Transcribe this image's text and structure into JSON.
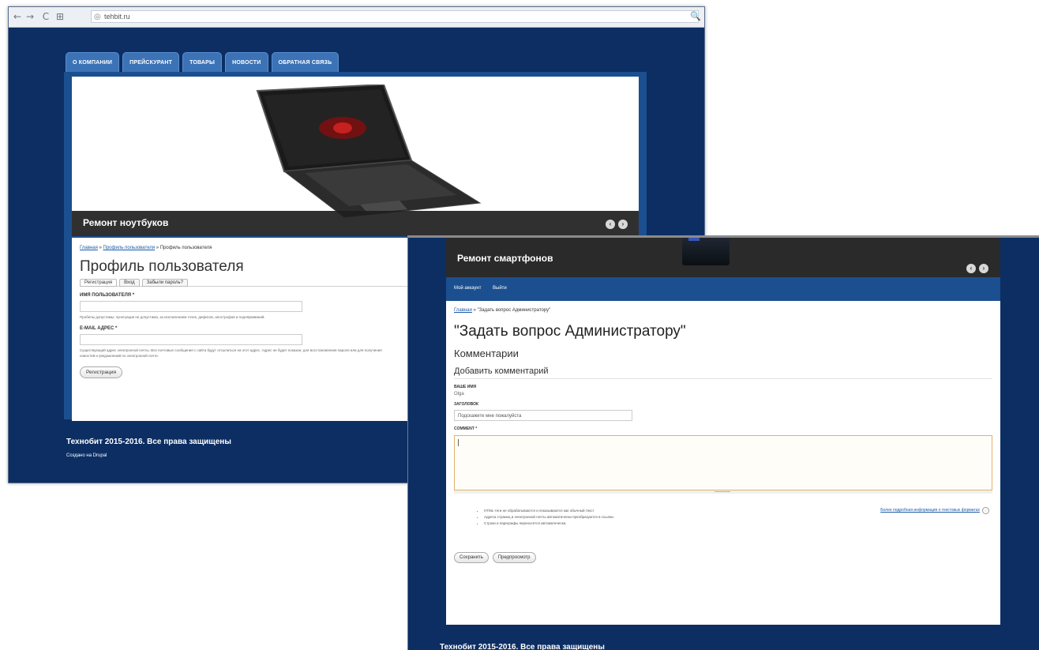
{
  "browser": {
    "back_icon": "←",
    "forward_icon": "→",
    "reload_icon": "C",
    "apps_icon": "⊞",
    "address": "tehbit.ru",
    "site_icon": "◎",
    "search_icon": "🔍"
  },
  "back_page": {
    "menu": [
      "О КОМПАНИИ",
      "ПРЕЙСКУРАНТ",
      "ТОВАРЫ",
      "НОВОСТИ",
      "ОБРАТНАЯ СВЯЗЬ"
    ],
    "slide_caption": "Ремонт ноутбуков",
    "slide_prev": "‹",
    "slide_next": "›",
    "breadcrumb": {
      "home": "Главная",
      "sep1": " » ",
      "profile": "Профиль пользователя",
      "sep2": " » ",
      "current": "Профиль пользователя"
    },
    "title": "Профиль пользователя",
    "tabs": [
      "Регистрация",
      "Вход",
      "Забыли пароль?"
    ],
    "form": {
      "username_label": "ИМЯ ПОЛЬЗОВАТЕЛЯ *",
      "username_hint": "Пробелы допустимы; пунктуация не допустима, за исключением точек, дефисов, апострофов и подчёркиваний.",
      "email_label": "E-MAIL АДРЕС *",
      "email_hint": "Существующий адрес электронной почты. Все почтовые сообщения с сайта будут отсылаться на этот адрес. Адрес не будет показан; для восстановления пароля или для получения новостей и уведомлений по электронной почте.",
      "submit": "Регистрация"
    },
    "footer_copyright": "Технобит 2015-2016. Все права защищены",
    "footer_credit": "Создано на Drupal"
  },
  "front_page": {
    "slide_caption": "Ремонт смартфонов",
    "slide_prev": "‹",
    "slide_next": "›",
    "user_menu": [
      "Мой аккаунт",
      "Выйти"
    ],
    "breadcrumb": {
      "home": "Главная",
      "sep": " » ",
      "current": "\"Задать вопрос Администратору\""
    },
    "title": "\"Задать вопрос Администратору\"",
    "comments_heading": "Комментарии",
    "add_comment_heading": "Добавить комментарий",
    "name_label": "ВАШЕ ИМЯ",
    "name_value": "Olga",
    "subject_label": "ЗАГОЛОВОК",
    "subject_value": "Подскажите мне пожалуйста",
    "comment_label": "COMMENT *",
    "tips": [
      "HTML-теги не обрабатываются и показываются как обычный текст",
      "Адреса страниц и электронной почты автоматически преобразуются в ссылки.",
      "Строки и параграфы переносятся автоматически."
    ],
    "more_info": "Более подробная информация о текстовых форматах",
    "help_icon": "?",
    "save_button": "Сохранить",
    "preview_button": "Предпросмотр",
    "footer_copyright": "Технобит 2015-2016. Все права защищены"
  },
  "colors": {
    "site_background": "#0c2e63",
    "menu_tab": "#3b73b6",
    "link": "#1a5aa6",
    "caption_bar": "#2a2a2a",
    "textarea_border": "#e0b26a"
  }
}
